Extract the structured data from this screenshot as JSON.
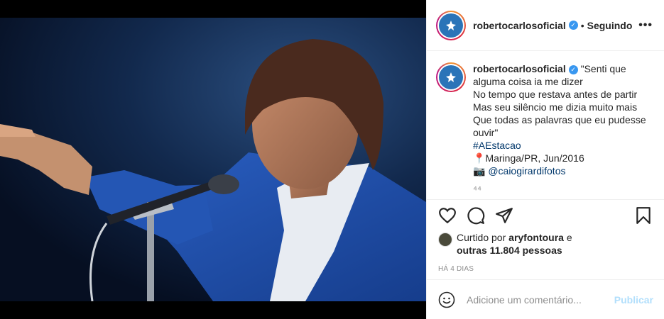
{
  "post": {
    "username": "robertocarlosoficial",
    "separator": "•",
    "follow_status": "Seguindo",
    "more_icon": "•••"
  },
  "caption": {
    "username": "robertocarlosoficial",
    "lines": [
      "\"Senti que alguma coisa ia me dizer",
      "No tempo que restava antes de partir",
      "Mas seu silêncio me dizia muito mais",
      "Que todas as palavras que eu pudesse ouvir\""
    ],
    "hashtag": "#AEstacao",
    "location_pin": "📍",
    "location": "Maringa/PR, Jun/2016",
    "camera_icon": "📷",
    "photo_credit": "@caiogirardifotos",
    "truncated": "⁴⁴"
  },
  "likes": {
    "prefix": "Curtido por",
    "liker": "aryfontoura",
    "conjunction": "e",
    "others": "outras 11.804 pessoas"
  },
  "timestamp": "HÁ 4 DIAS",
  "comment_box": {
    "placeholder": "Adicione um comentário...",
    "publish_label": "Publicar"
  },
  "colors": {
    "accent": "#3897f0",
    "publish_disabled": "#b2dffc",
    "link": "#00376b",
    "jacket_blue": "#1f4fa8"
  }
}
